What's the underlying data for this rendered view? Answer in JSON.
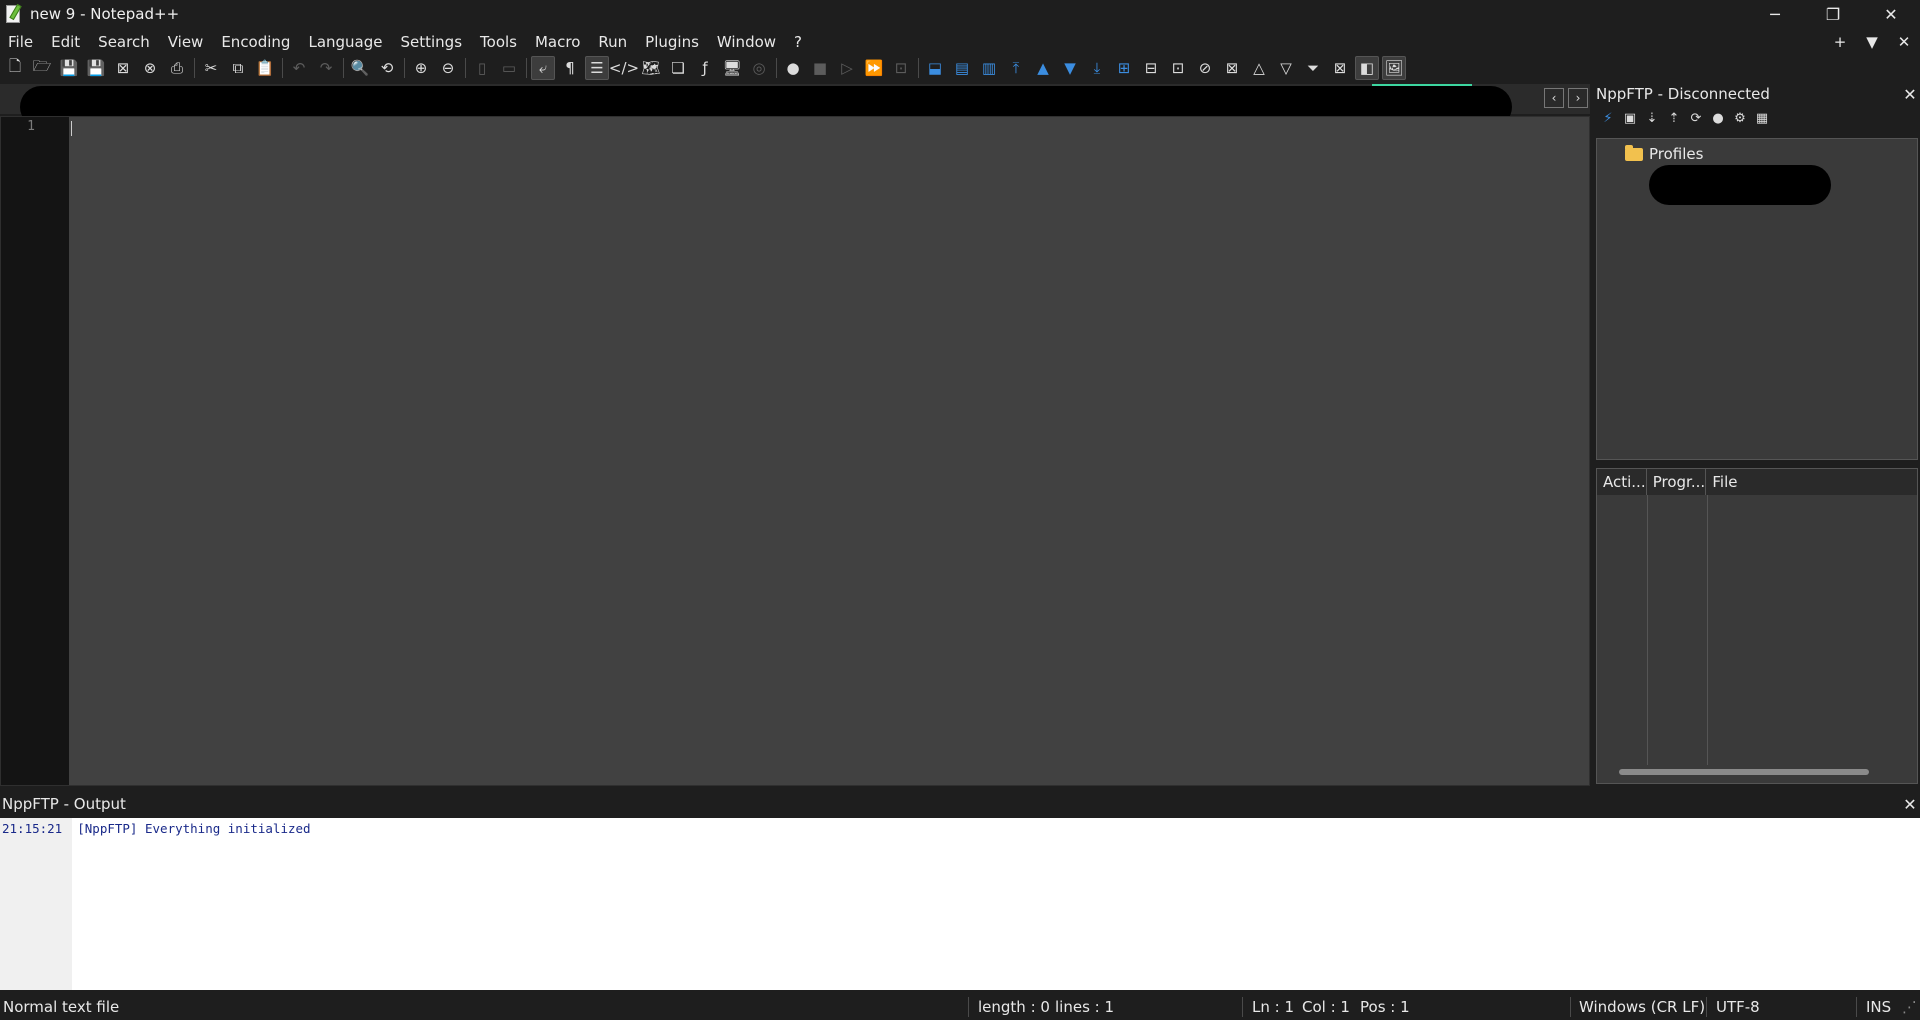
{
  "window": {
    "title": "new 9 - Notepad++",
    "controls": {
      "minimize": "─",
      "restore": "❐",
      "close": "✕"
    }
  },
  "menu": {
    "items": [
      "File",
      "Edit",
      "Search",
      "View",
      "Encoding",
      "Language",
      "Settings",
      "Tools",
      "Macro",
      "Run",
      "Plugins",
      "Window",
      "?"
    ],
    "right": {
      "new_tab": "+",
      "dropdown": "▼",
      "close_doc": "✕"
    }
  },
  "toolbar": {
    "icons": [
      {
        "name": "new-file-icon",
        "glyph": "🗋"
      },
      {
        "name": "open-file-icon",
        "glyph": "🗁"
      },
      {
        "name": "save-icon",
        "glyph": "💾",
        "dim": true
      },
      {
        "name": "save-all-icon",
        "glyph": "💾"
      },
      {
        "name": "close-icon",
        "glyph": "⊠"
      },
      {
        "name": "close-all-icon",
        "glyph": "⊗"
      },
      {
        "name": "print-icon",
        "glyph": "⎙"
      },
      {
        "sep": true
      },
      {
        "name": "cut-icon",
        "glyph": "✂"
      },
      {
        "name": "copy-icon",
        "glyph": "⧉"
      },
      {
        "name": "paste-icon",
        "glyph": "📋"
      },
      {
        "sep": true
      },
      {
        "name": "undo-icon",
        "glyph": "↶",
        "dim": true
      },
      {
        "name": "redo-icon",
        "glyph": "↷",
        "dim": true
      },
      {
        "sep": true
      },
      {
        "name": "find-icon",
        "glyph": "🔍"
      },
      {
        "name": "replace-icon",
        "glyph": "⟲"
      },
      {
        "sep": true
      },
      {
        "name": "zoom-in-icon",
        "glyph": "⊕"
      },
      {
        "name": "zoom-out-icon",
        "glyph": "⊖"
      },
      {
        "sep": true
      },
      {
        "name": "sync-vertical-icon",
        "glyph": "▯",
        "dim": true
      },
      {
        "name": "sync-horizontal-icon",
        "glyph": "▭",
        "dim": true
      },
      {
        "sep": true
      },
      {
        "name": "word-wrap-icon",
        "glyph": "⤶",
        "active": true
      },
      {
        "name": "show-all-chars-icon",
        "glyph": "¶"
      },
      {
        "name": "indent-guide-icon",
        "glyph": "☰",
        "active": true
      },
      {
        "name": "xml-tag-icon",
        "glyph": "</>"
      },
      {
        "name": "document-map-icon",
        "glyph": "🗺"
      },
      {
        "name": "document-list-icon",
        "glyph": "❏"
      },
      {
        "name": "function-list-icon",
        "glyph": "ƒ"
      },
      {
        "name": "folder-workspace-icon",
        "glyph": "🖥"
      },
      {
        "name": "monitoring-icon",
        "glyph": "◎",
        "dim": true
      },
      {
        "sep": true
      },
      {
        "name": "record-macro-icon",
        "glyph": "●"
      },
      {
        "name": "stop-macro-icon",
        "glyph": "■",
        "dim": true
      },
      {
        "name": "play-macro-icon",
        "glyph": "▷",
        "dim": true
      },
      {
        "name": "run-macro-multiple-icon",
        "glyph": "⏩"
      },
      {
        "name": "save-macro-icon",
        "glyph": "⊡",
        "dim": true
      },
      {
        "sep": true
      },
      {
        "name": "compare-icon",
        "glyph": "⬓",
        "blue": true
      },
      {
        "name": "compare-diff-icon",
        "glyph": "▤",
        "blue": true
      },
      {
        "name": "compare-clear-icon",
        "glyph": "▥",
        "blue": true
      },
      {
        "name": "first-diff-icon",
        "glyph": "⤒",
        "blue": true
      },
      {
        "name": "prev-diff-icon",
        "glyph": "▲",
        "blue": true
      },
      {
        "name": "next-diff-icon",
        "glyph": "▼",
        "blue": true
      },
      {
        "name": "last-diff-icon",
        "glyph": "⤓",
        "blue": true
      },
      {
        "name": "compare-options-icon",
        "glyph": "⊞",
        "blue": true
      },
      {
        "name": "diff-bookmark-icon",
        "glyph": "⊟"
      },
      {
        "name": "diff-select-icon",
        "glyph": "⊡"
      },
      {
        "name": "diff-swap-icon",
        "glyph": "⊘"
      },
      {
        "name": "diff-clear-icon",
        "glyph": "⊠"
      },
      {
        "name": "up-icon",
        "glyph": "△"
      },
      {
        "name": "down-icon",
        "glyph": "▽"
      },
      {
        "name": "bottom-icon",
        "glyph": "⏷"
      },
      {
        "name": "clear-all-icon",
        "glyph": "⊠"
      },
      {
        "name": "panel-icon",
        "glyph": "◧",
        "active": true
      },
      {
        "name": "image-icon",
        "glyph": "🖼",
        "active": true
      }
    ]
  },
  "tabs": {
    "prev": "‹",
    "next": "›"
  },
  "editor": {
    "line_numbers": [
      "1"
    ]
  },
  "ftp": {
    "title": "NppFTP - Disconnected",
    "close": "✕",
    "toolbar": [
      {
        "name": "connect-icon",
        "glyph": "⚡",
        "blue": true
      },
      {
        "name": "disconnect-icon",
        "glyph": "▣"
      },
      {
        "name": "download-icon",
        "glyph": "⇣"
      },
      {
        "name": "upload-icon",
        "glyph": "⇡"
      },
      {
        "name": "refresh-icon",
        "glyph": "⟳"
      },
      {
        "name": "abort-icon",
        "glyph": "●"
      },
      {
        "name": "settings-gear-icon",
        "glyph": "⚙"
      },
      {
        "name": "message-window-icon",
        "glyph": "▦"
      }
    ],
    "tree": {
      "root": "Profiles"
    },
    "queue": {
      "columns": [
        "Acti...",
        "Progr...",
        "File"
      ]
    }
  },
  "output": {
    "title": "NppFTP - Output",
    "close": "✕",
    "lines": [
      "21:15:21  [NppFTP] Everything initialized"
    ]
  },
  "status": {
    "file_type": "Normal text file",
    "length": "length : 0",
    "lines": "lines : 1",
    "ln": "Ln : 1",
    "col": "Col : 1",
    "pos": "Pos : 1",
    "eol": "Windows (CR LF)",
    "encoding": "UTF-8",
    "mode": "INS"
  }
}
